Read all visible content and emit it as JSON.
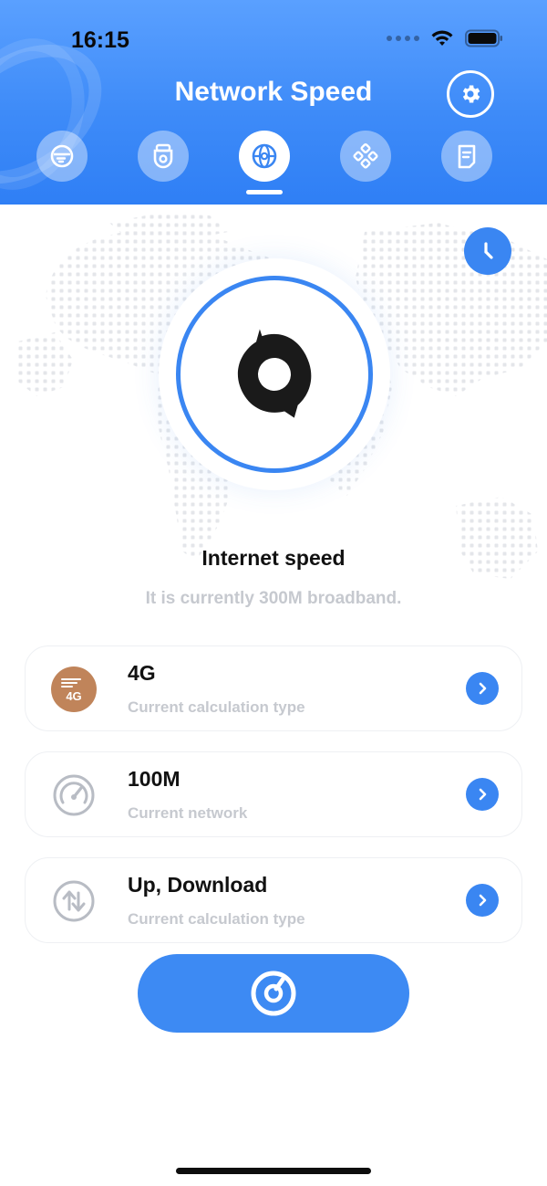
{
  "status": {
    "time": "16:15"
  },
  "header": {
    "title": "Network Speed"
  },
  "tabs": [
    {
      "icon": "wifi-router-icon",
      "active": false
    },
    {
      "icon": "camera-icon",
      "active": false
    },
    {
      "icon": "globe-icon",
      "active": true
    },
    {
      "icon": "grid-icon",
      "active": false
    },
    {
      "icon": "document-icon",
      "active": false
    }
  ],
  "main": {
    "speed_title": "Internet speed",
    "speed_subtitle": "It is currently 300M broadband."
  },
  "cards": [
    {
      "icon": "4g-icon",
      "badge": "4G",
      "title": "4G",
      "subtitle": "Current calculation type"
    },
    {
      "icon": "speedometer-icon",
      "title": "100M",
      "subtitle": "Current network"
    },
    {
      "icon": "up-down-arrows-icon",
      "title": "Up, Download",
      "subtitle": "Current calculation type"
    }
  ],
  "colors": {
    "accent": "#3a86f2",
    "header_top": "#5aa0ff",
    "header_bottom": "#2f7ff5",
    "badge_4g": "#c0845a",
    "muted": "#c6c9cf"
  }
}
